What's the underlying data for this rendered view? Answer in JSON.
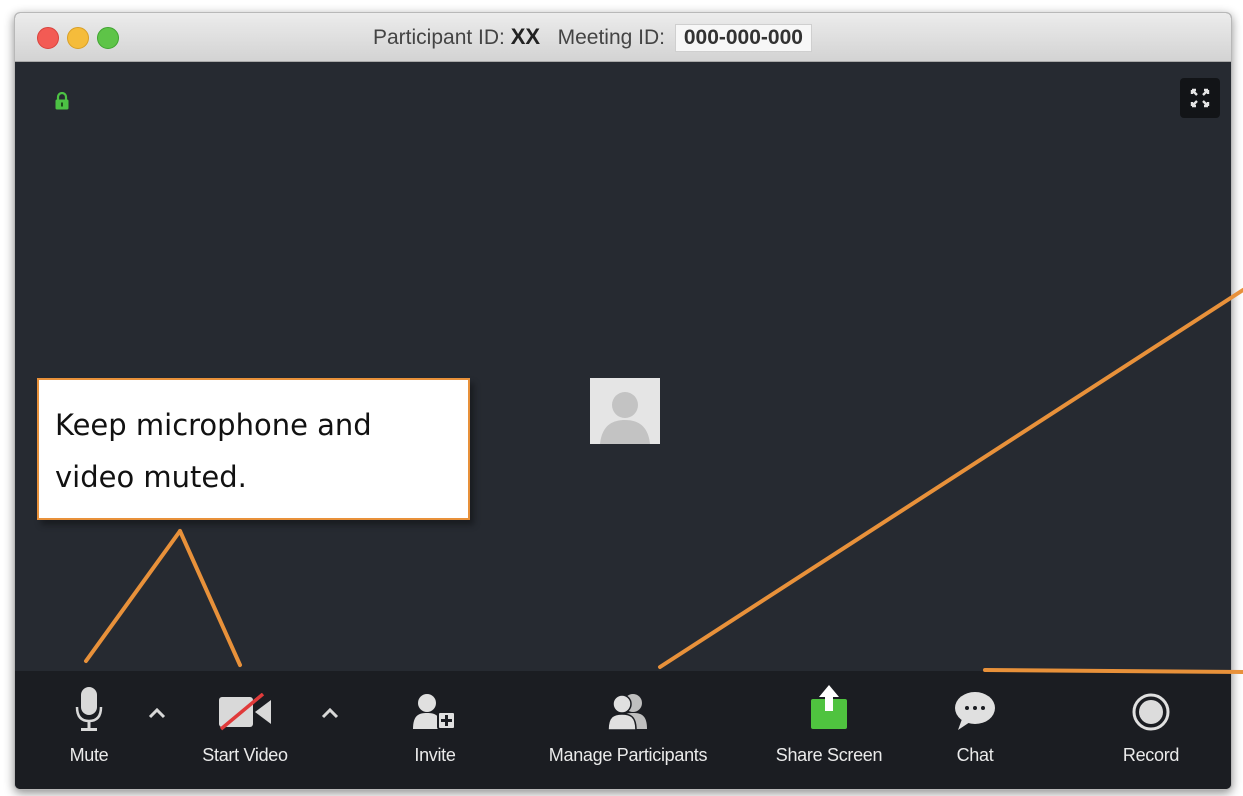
{
  "window": {
    "title_participant_label": "Participant ID:",
    "participant_id": "XX",
    "title_meeting_label": "Meeting ID:",
    "meeting_id": "000-000-000"
  },
  "callout": {
    "line1": "Keep microphone and",
    "line2": "video muted."
  },
  "toolbar": {
    "mute_label": "Mute",
    "start_video_label": "Start Video",
    "invite_label": "Invite",
    "manage_participants_label": "Manage Participants",
    "share_screen_label": "Share Screen",
    "chat_label": "Chat",
    "record_label": "Record"
  },
  "colors": {
    "accent_orange": "#e8913a",
    "share_green": "#4fc33f",
    "lock_green": "#4cc244",
    "video_off_red": "#e03a3a"
  },
  "icons": [
    "lock-icon",
    "fullscreen-icon",
    "avatar-icon",
    "microphone-icon",
    "video-off-icon",
    "invite-icon",
    "participants-icon",
    "share-screen-icon",
    "chat-icon",
    "record-icon",
    "caret-up-icon"
  ]
}
